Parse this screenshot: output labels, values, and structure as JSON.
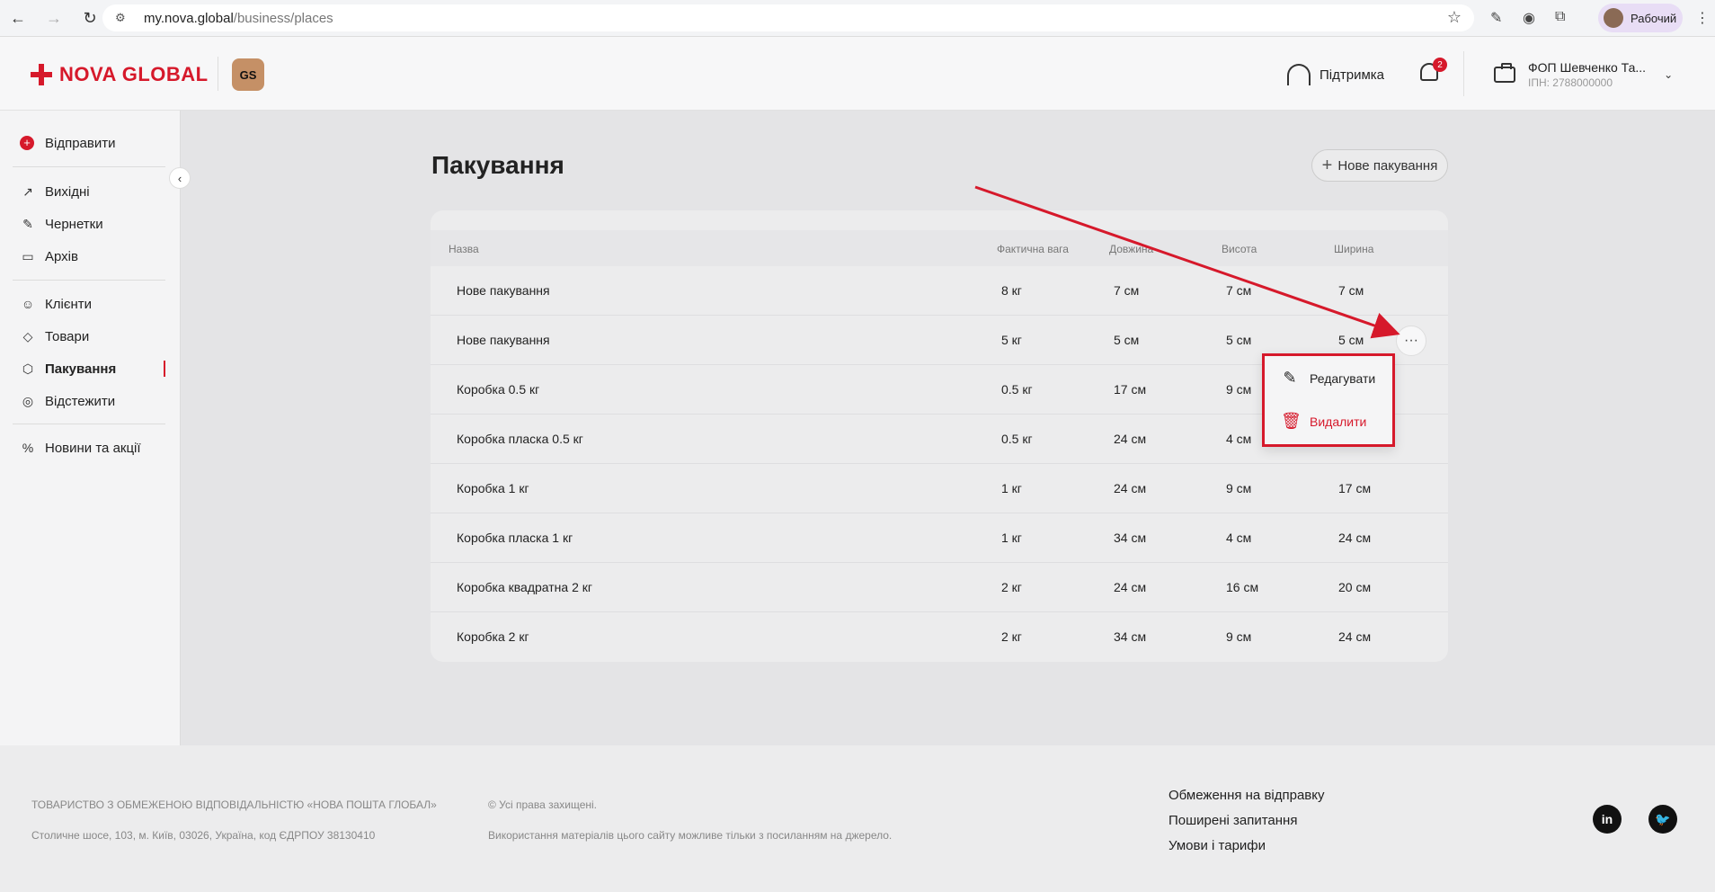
{
  "browser": {
    "url_host": "my.nova.global",
    "url_path": "/business/places",
    "profile_label": "Рабочий"
  },
  "header": {
    "logo_text": "NOVA GLOBAL",
    "gs_badge": "GS",
    "support_label": "Підтримка",
    "notifications_count": "2",
    "account_name": "ФОП Шевченко Та...",
    "account_tax_id": "ІПН: 2788000000"
  },
  "sidebar": {
    "send_label": "Відправити",
    "items": [
      {
        "label": "Вихідні",
        "icon": "arrow-up-right-icon"
      },
      {
        "label": "Чернетки",
        "icon": "edit-icon"
      },
      {
        "label": "Архів",
        "icon": "archive-icon"
      },
      {
        "label": "Клієнти",
        "icon": "users-icon"
      },
      {
        "label": "Товари",
        "icon": "tag-icon"
      },
      {
        "label": "Пакування",
        "icon": "box-icon"
      },
      {
        "label": "Відстежити",
        "icon": "track-icon"
      },
      {
        "label": "Новини та акції",
        "icon": "percent-icon"
      }
    ]
  },
  "main": {
    "title": "Пакування",
    "new_button_label": "Нове пакування",
    "columns": [
      "Назва",
      "Фактична вага",
      "Довжина",
      "Висота",
      "Ширина"
    ],
    "rows": [
      [
        "Нове пакування",
        "8 кг",
        "7 см",
        "7 см",
        "7 см"
      ],
      [
        "Нове пакування",
        "5 кг",
        "5 см",
        "5 см",
        "5 см"
      ],
      [
        "Коробка 0.5 кг",
        "0.5 кг",
        "17 см",
        "9 см",
        ""
      ],
      [
        "Коробка пласка 0.5 кг",
        "0.5 кг",
        "24 см",
        "4 см",
        ""
      ],
      [
        "Коробка 1 кг",
        "1 кг",
        "24 см",
        "9 см",
        "17 см"
      ],
      [
        "Коробка пласка 1 кг",
        "1 кг",
        "34 см",
        "4 см",
        "24 см"
      ],
      [
        "Коробка квадратна 2 кг",
        "2 кг",
        "24 см",
        "16 см",
        "20 см"
      ],
      [
        "Коробка 2 кг",
        "2 кг",
        "34 см",
        "9 см",
        "24 см"
      ]
    ],
    "more_button": "···",
    "context_menu": {
      "edit_label": "Редагувати",
      "delete_label": "Видалити"
    }
  },
  "footer": {
    "company": "ТОВАРИСТВО З ОБМЕЖЕНОЮ ВІДПОВІДАЛЬНІСТЮ «НОВА ПОШТА ГЛОБАЛ»",
    "address": "Столичне шосе, 103, м. Київ, 03026, Україна, код ЄДРПОУ 38130410",
    "rights": "© Усі права захищені.",
    "usage_note": "Використання матеріалів цього сайту можливе тільки з посиланням на джерело.",
    "links": [
      "Обмеження на відправку",
      "Поширені запитання",
      "Умови і тарифи"
    ],
    "social_linkedin": "in",
    "social_twitter": "🐦"
  },
  "colors": {
    "brand_red": "#d6192b",
    "annotation_red": "#d6192b"
  }
}
